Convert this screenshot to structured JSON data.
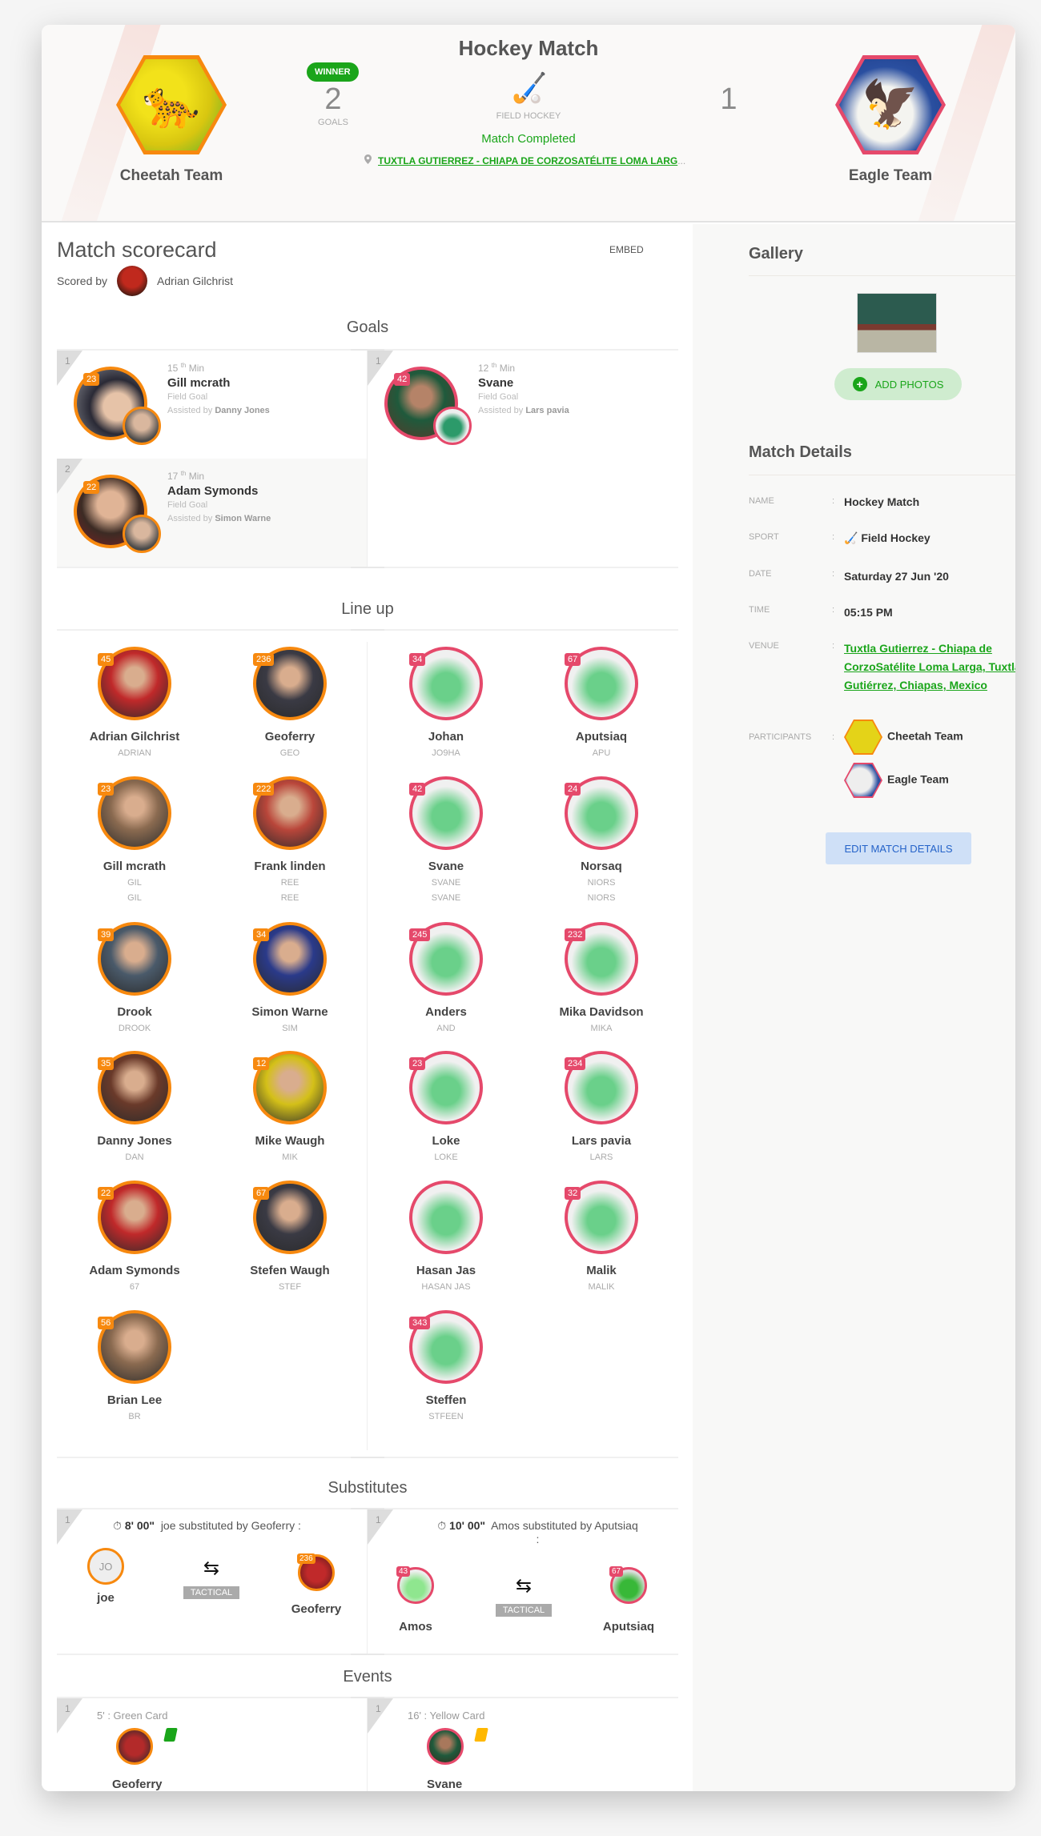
{
  "header": {
    "title": "Hockey Match",
    "home_team": {
      "name": "Cheetah Team",
      "score": "2",
      "winner_badge": "WINNER",
      "goals_label": "GOALS"
    },
    "away_team": {
      "name": "Eagle Team",
      "score": "1"
    },
    "sport_label": "FIELD HOCKEY",
    "status": "Match Completed",
    "venue_short": "TUXTLA GUTIERREZ - CHIAPA DE CORZOSATÉLITE LOMA LARG",
    "venue_ellipsis": "..."
  },
  "scorecard": {
    "title": "Match scorecard",
    "embed_label": "EMBED",
    "scored_by_label": "Scored by",
    "scorer": "Adrian Gilchrist"
  },
  "goals": {
    "title": "Goals",
    "items": [
      {
        "index": "1",
        "minute": "15",
        "suffix": "th",
        "min_label": "Min",
        "player": "Gill mcrath",
        "jersey": "23",
        "type": "Field Goal",
        "assist_prefix": "Assisted by",
        "assist": "Danny Jones"
      },
      {
        "index": "1",
        "minute": "12",
        "suffix": "th",
        "min_label": "Min",
        "player": "Svane",
        "jersey": "42",
        "type": "Field Goal",
        "assist_prefix": "Assisted by",
        "assist": "Lars pavia"
      },
      {
        "index": "2",
        "minute": "17",
        "suffix": "th",
        "min_label": "Min",
        "player": "Adam Symonds",
        "jersey": "22",
        "type": "Field Goal",
        "assist_prefix": "Assisted by",
        "assist": "Simon Warne"
      }
    ]
  },
  "lineup": {
    "title": "Line up",
    "home": [
      {
        "name": "Adrian Gilchrist",
        "short": "ADRIAN",
        "jersey": "45"
      },
      {
        "name": "Geoferry",
        "short": "GEO",
        "jersey": "236"
      },
      {
        "name": "Gill mcrath",
        "short": "GIL",
        "short2": "GIL",
        "jersey": "23"
      },
      {
        "name": "Frank linden",
        "short": "REE",
        "short2": "REE",
        "jersey": "222"
      },
      {
        "name": "Drook",
        "short": "DROOK",
        "jersey": "39"
      },
      {
        "name": "Simon Warne",
        "short": "SIM",
        "jersey": "34"
      },
      {
        "name": "Danny Jones",
        "short": "DAN",
        "jersey": "35"
      },
      {
        "name": "Mike Waugh",
        "short": "MIK",
        "jersey": "12"
      },
      {
        "name": "Adam Symonds",
        "short": "67",
        "jersey": "22"
      },
      {
        "name": "Stefen Waugh",
        "short": "STEF",
        "jersey": "67"
      },
      {
        "name": "Brian Lee",
        "short": "BR",
        "jersey": "56"
      }
    ],
    "away": [
      {
        "name": "Johan",
        "short": "JO9HA",
        "jersey": "34"
      },
      {
        "name": "Aputsiaq",
        "short": "APU",
        "jersey": "67"
      },
      {
        "name": "Svane",
        "short": "SVANE",
        "short2": "SVANE",
        "jersey": "42"
      },
      {
        "name": "Norsaq",
        "short": "NIORS",
        "short2": "NIORS",
        "jersey": "24"
      },
      {
        "name": "Anders",
        "short": "AND",
        "jersey": "245"
      },
      {
        "name": "Mika Davidson",
        "short": "MIKA",
        "jersey": "232"
      },
      {
        "name": "Loke",
        "short": "LOKE",
        "jersey": "23"
      },
      {
        "name": "Lars pavia",
        "short": "LARS",
        "jersey": "234"
      },
      {
        "name": "Hasan Jas",
        "short": "HASAN JAS",
        "jersey": ""
      },
      {
        "name": "Malik",
        "short": "MALIK",
        "jersey": "32"
      },
      {
        "name": "Steffen",
        "short": "STFEEN",
        "jersey": "343"
      }
    ]
  },
  "substitutes": {
    "title": "Substitutes",
    "items": [
      {
        "index": "1",
        "time": "8' 00\"",
        "text": "joe substituted by Geoferry :",
        "out_name": "joe",
        "out_initials": "JO",
        "in_name": "Geoferry",
        "in_jersey": "236",
        "reason": "TACTICAL"
      },
      {
        "index": "1",
        "time": "10' 00\"",
        "text": "Amos substituted by Aputsiaq",
        "text2": ":",
        "out_name": "Amos",
        "out_jersey": "43",
        "in_name": "Aputsiaq",
        "in_jersey": "67",
        "reason": "TACTICAL"
      }
    ]
  },
  "events": {
    "title": "Events",
    "items": [
      {
        "index": "1",
        "label": "5' : Green Card",
        "player": "Geoferry",
        "card_color": "#1aa51a"
      },
      {
        "index": "1",
        "label": "16' : Yellow Card",
        "player": "Svane",
        "card_color": "#ffb800"
      }
    ]
  },
  "sidebar": {
    "gallery_title": "Gallery",
    "add_photos_label": "ADD PHOTOS",
    "details_title": "Match Details",
    "details": {
      "name_label": "NAME",
      "name": "Hockey Match",
      "sport_label": "SPORT",
      "sport": "Field Hockey",
      "date_label": "DATE",
      "date": "Saturday 27 Jun '20",
      "time_label": "TIME",
      "time": "05:15 PM",
      "venue_label": "VENUE",
      "venue": "Tuxtla Gutierrez - Chiapa de CorzoSatélite Loma Larga, Tuxtla Gutiérrez, Chiapas, Mexico",
      "participants_label": "PARTICIPANTS",
      "participants": [
        "Cheetah Team",
        "Eagle Team"
      ],
      "colon": ":"
    },
    "edit_label": "EDIT MATCH DETAILS"
  },
  "colors": {
    "home": "#f7890f",
    "away": "#e5496b",
    "accent": "#1aa51a"
  }
}
